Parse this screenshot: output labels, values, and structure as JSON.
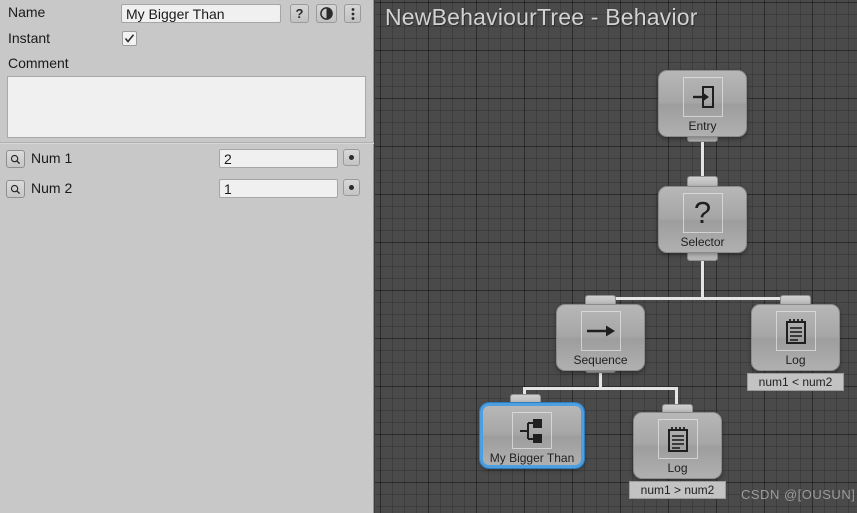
{
  "inspector": {
    "name_label": "Name",
    "name_value": "My Bigger Than",
    "help_icon": "question-mark-icon",
    "preset_icon": "contrast-circle-icon",
    "menu_icon": "vertical-dots-icon",
    "instant_label": "Instant",
    "instant_checked": true,
    "comment_label": "Comment",
    "comment_value": "",
    "fields": [
      {
        "label": "Num 1",
        "value": "2",
        "search_icon": "magnifier-icon",
        "dot_icon": "record-dot-icon"
      },
      {
        "label": "Num 2",
        "value": "1",
        "search_icon": "magnifier-icon",
        "dot_icon": "record-dot-icon"
      }
    ]
  },
  "graph": {
    "title": "NewBehaviourTree - Behavior",
    "watermark": "CSDN @[OUSUN]",
    "nodes": [
      {
        "id": "entry",
        "label": "Entry",
        "icon": "enter-arrow-icon",
        "comment": ""
      },
      {
        "id": "selector",
        "label": "Selector",
        "icon": "question-mark-icon",
        "comment": ""
      },
      {
        "id": "sequence",
        "label": "Sequence",
        "icon": "right-arrow-icon",
        "comment": ""
      },
      {
        "id": "log1",
        "label": "Log",
        "icon": "notepad-icon",
        "comment": "num1 < num2"
      },
      {
        "id": "mybigger",
        "label": "My Bigger Than",
        "icon": "branch-nodes-icon",
        "comment": "",
        "selected": true
      },
      {
        "id": "log2",
        "label": "Log",
        "icon": "notepad-icon",
        "comment": "num1 > num2"
      }
    ]
  },
  "colors": {
    "panel_bg": "#c8c8c8",
    "canvas_bg": "#4a4a4a",
    "node_fill": "#ababab",
    "selection": "#4e9fe0",
    "connection": "#e4e4e4",
    "input_bg": "#f0f0f0"
  }
}
